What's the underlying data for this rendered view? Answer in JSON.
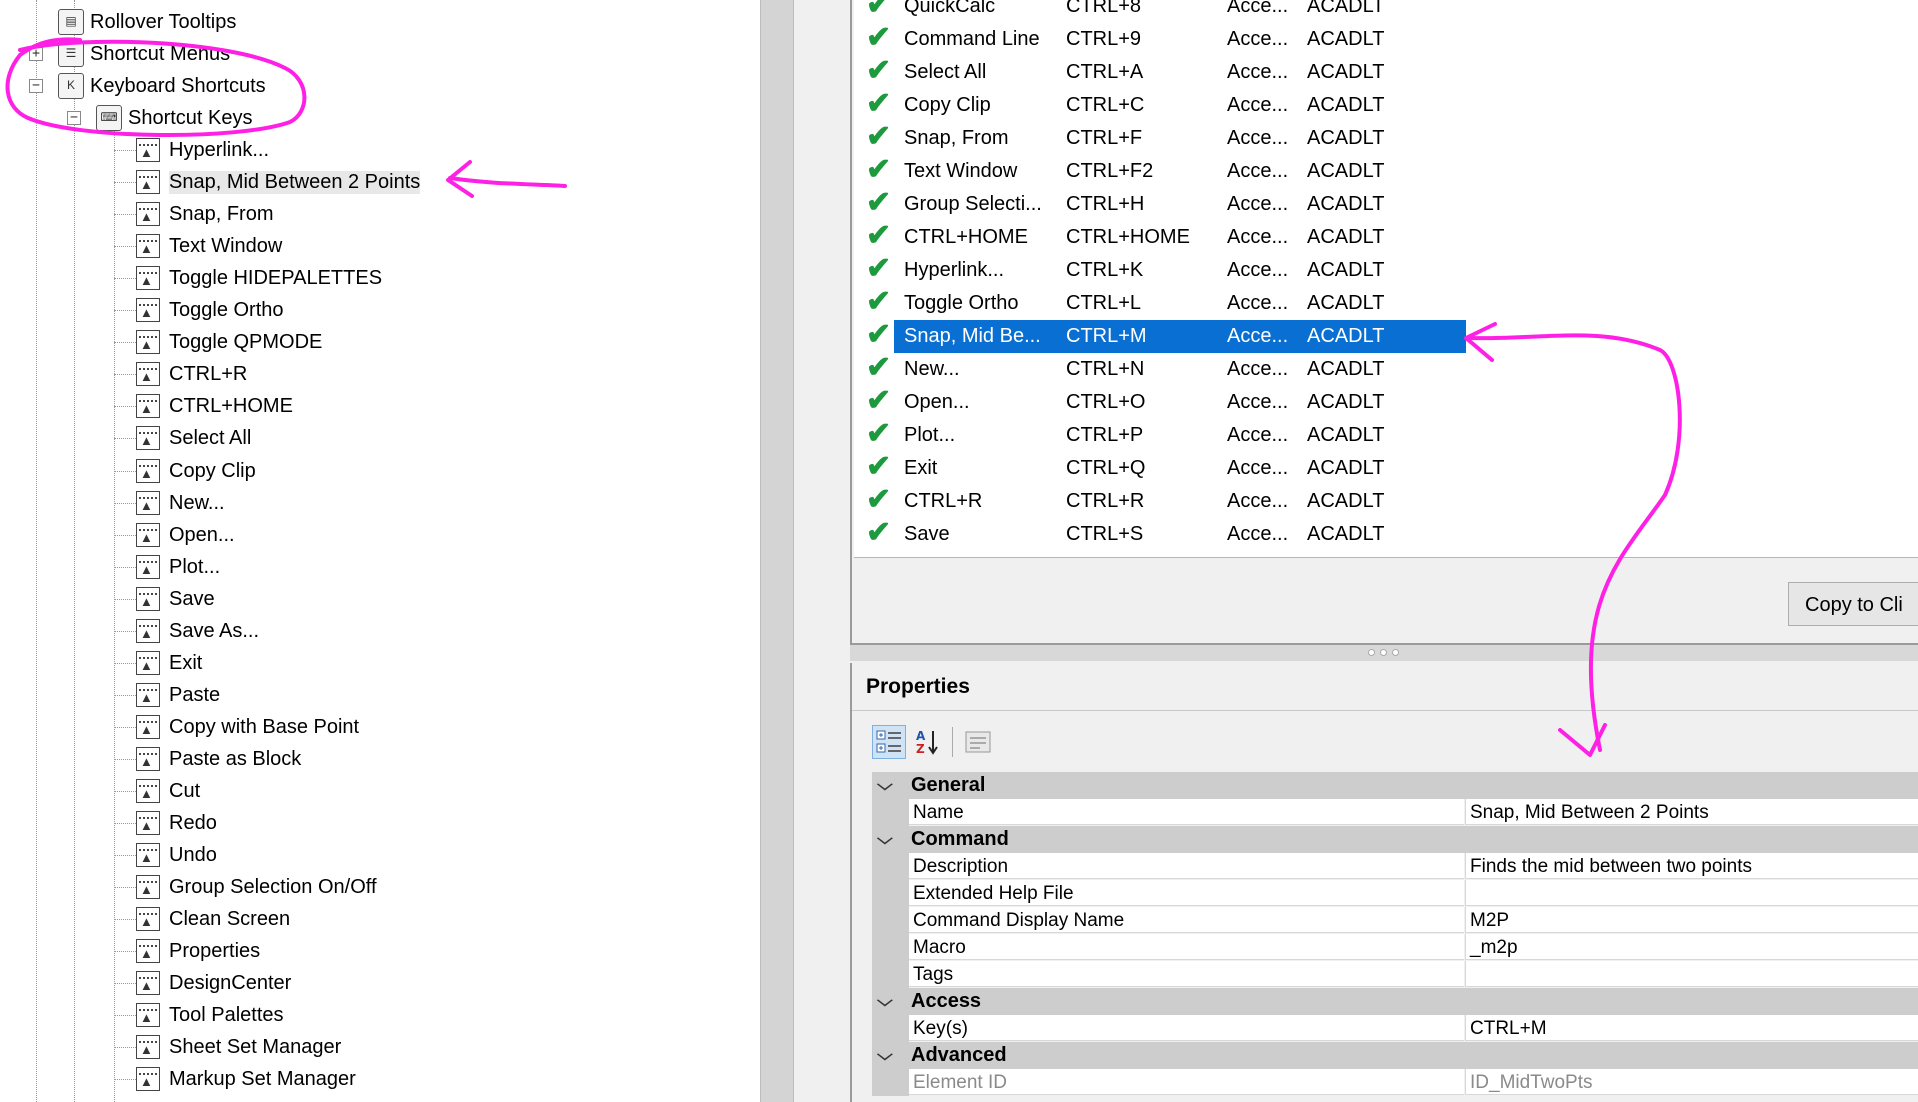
{
  "tree": {
    "top_nodes": [
      {
        "label": "Rollover Tooltips"
      },
      {
        "label": "Shortcut Menus"
      },
      {
        "label": "Keyboard Shortcuts"
      },
      {
        "label": "Shortcut Keys"
      }
    ],
    "items": [
      "Hyperlink...",
      "Snap, Mid Between 2 Points",
      "Snap, From",
      "Text Window",
      "Toggle HIDEPALETTES",
      "Toggle Ortho",
      "Toggle QPMODE",
      "CTRL+R",
      "CTRL+HOME",
      "Select All",
      "Copy Clip",
      "New...",
      "Open...",
      "Plot...",
      "Save",
      "Save As...",
      "Exit",
      "Paste",
      "Copy with Base Point",
      "Paste as Block",
      "Cut",
      "Redo",
      "Undo",
      "Group Selection On/Off",
      "Clean Screen",
      "Properties",
      "DesignCenter",
      "Tool Palettes",
      "Sheet Set Manager",
      "Markup Set Manager"
    ],
    "selected_item": "Snap, Mid Between 2 Points"
  },
  "shortcut_list": {
    "rows": [
      {
        "command": "QuickCalc",
        "key": "CTRL+8",
        "type": "Acce...",
        "source": "ACADLT"
      },
      {
        "command": "Command Line",
        "key": "CTRL+9",
        "type": "Acce...",
        "source": "ACADLT"
      },
      {
        "command": "Select All",
        "key": "CTRL+A",
        "type": "Acce...",
        "source": "ACADLT"
      },
      {
        "command": "Copy Clip",
        "key": "CTRL+C",
        "type": "Acce...",
        "source": "ACADLT"
      },
      {
        "command": "Snap, From",
        "key": "CTRL+F",
        "type": "Acce...",
        "source": "ACADLT"
      },
      {
        "command": "Text Window",
        "key": "CTRL+F2",
        "type": "Acce...",
        "source": "ACADLT"
      },
      {
        "command": "Group Selecti...",
        "key": "CTRL+H",
        "type": "Acce...",
        "source": "ACADLT"
      },
      {
        "command": "CTRL+HOME",
        "key": "CTRL+HOME",
        "type": "Acce...",
        "source": "ACADLT"
      },
      {
        "command": "Hyperlink...",
        "key": "CTRL+K",
        "type": "Acce...",
        "source": "ACADLT"
      },
      {
        "command": "Toggle Ortho",
        "key": "CTRL+L",
        "type": "Acce...",
        "source": "ACADLT"
      },
      {
        "command": "Snap, Mid Be...",
        "key": "CTRL+M",
        "type": "Acce...",
        "source": "ACADLT",
        "selected": true
      },
      {
        "command": "New...",
        "key": "CTRL+N",
        "type": "Acce...",
        "source": "ACADLT"
      },
      {
        "command": "Open...",
        "key": "CTRL+O",
        "type": "Acce...",
        "source": "ACADLT"
      },
      {
        "command": "Plot...",
        "key": "CTRL+P",
        "type": "Acce...",
        "source": "ACADLT"
      },
      {
        "command": "Exit",
        "key": "CTRL+Q",
        "type": "Acce...",
        "source": "ACADLT"
      },
      {
        "command": "CTRL+R",
        "key": "CTRL+R",
        "type": "Acce...",
        "source": "ACADLT"
      },
      {
        "command": "Save",
        "key": "CTRL+S",
        "type": "Acce...",
        "source": "ACADLT"
      }
    ],
    "copy_button_label": "Copy to Cli"
  },
  "properties": {
    "title": "Properties",
    "categories": [
      {
        "label": "General",
        "rows": [
          {
            "name": "Name",
            "value": "Snap, Mid Between 2 Points"
          }
        ]
      },
      {
        "label": "Command",
        "rows": [
          {
            "name": "Description",
            "value": "Finds the mid between two points"
          },
          {
            "name": "Extended Help File",
            "value": ""
          },
          {
            "name": "Command Display Name",
            "value": "M2P"
          },
          {
            "name": "Macro",
            "value": "_m2p"
          },
          {
            "name": "Tags",
            "value": ""
          }
        ]
      },
      {
        "label": "Access",
        "rows": [
          {
            "name": "Key(s)",
            "value": "CTRL+M"
          }
        ]
      },
      {
        "label": "Advanced",
        "rows": [
          {
            "name": "Element ID",
            "value": "ID_MidTwoPts",
            "readonly": true
          }
        ]
      }
    ]
  },
  "colors": {
    "selection": "#0a6fd2",
    "check": "#1d9a3d",
    "annotation": "#ff20e6"
  }
}
